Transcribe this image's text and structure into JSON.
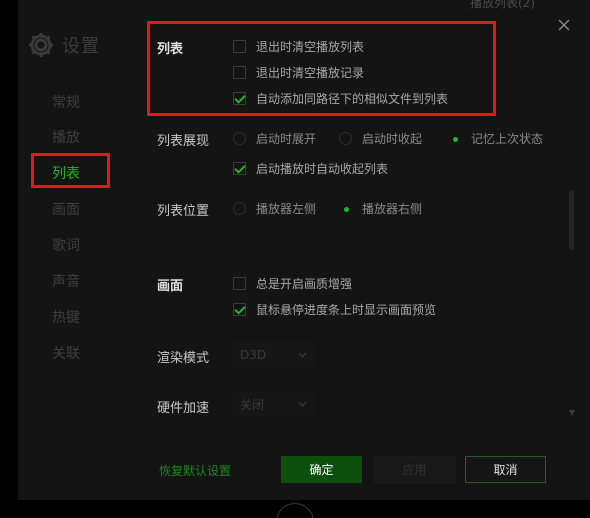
{
  "background_hint": "播放列表(2)",
  "sidebar": {
    "title": "设置",
    "items": [
      {
        "label": "常规"
      },
      {
        "label": "播放"
      },
      {
        "label": "列表"
      },
      {
        "label": "画面"
      },
      {
        "label": "歌词"
      },
      {
        "label": "声音"
      },
      {
        "label": "热键"
      },
      {
        "label": "关联"
      }
    ],
    "active_index": 2
  },
  "list_section": {
    "label": "列表",
    "options": [
      {
        "label": "退出时清空播放列表",
        "checked": false
      },
      {
        "label": "退出时清空播放记录",
        "checked": false
      },
      {
        "label": "自动添加同路径下的相似文件到列表",
        "checked": true
      }
    ]
  },
  "list_display": {
    "label": "列表展现",
    "radios": [
      {
        "label": "启动时展开",
        "selected": false
      },
      {
        "label": "启动时收起",
        "selected": false
      },
      {
        "label": "记忆上次状态",
        "selected": true
      }
    ],
    "option": {
      "label": "启动播放时自动收起列表",
      "checked": true
    }
  },
  "list_position": {
    "label": "列表位置",
    "radios": [
      {
        "label": "播放器左侧",
        "selected": false
      },
      {
        "label": "播放器右侧",
        "selected": true
      }
    ]
  },
  "picture_section": {
    "label": "画面",
    "options": [
      {
        "label": "总是开启画质增强",
        "checked": false
      },
      {
        "label": "鼠标悬停进度条上时显示画面预览",
        "checked": true
      }
    ],
    "render_mode": {
      "label": "渲染模式",
      "value": "D3D"
    },
    "hw_accel": {
      "label": "硬件加速",
      "value": "关闭"
    }
  },
  "footer": {
    "restore_label": "恢复默认设置",
    "ok_label": "确定",
    "apply_label": "应用",
    "cancel_label": "取消"
  },
  "colors": {
    "accent": "#1fb81f",
    "highlight": "#e31818",
    "ok_button": "#0d4f0d"
  }
}
